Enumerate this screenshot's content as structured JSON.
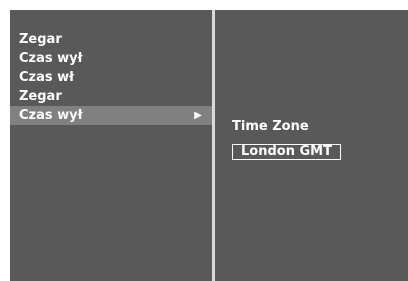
{
  "menu": {
    "items": [
      {
        "label": "Zegar"
      },
      {
        "label": "Czas wył"
      },
      {
        "label": "Czas wł"
      },
      {
        "label": "Zegar"
      },
      {
        "label": "Czas wył",
        "selected": true,
        "arrow": "▶"
      }
    ]
  },
  "submenu": {
    "title": "Time Zone",
    "value": "London GMT"
  },
  "colors": {
    "background": "#595959",
    "selected_row": "#808080",
    "divider": "#d9d9d9",
    "text": "#ffffff"
  }
}
